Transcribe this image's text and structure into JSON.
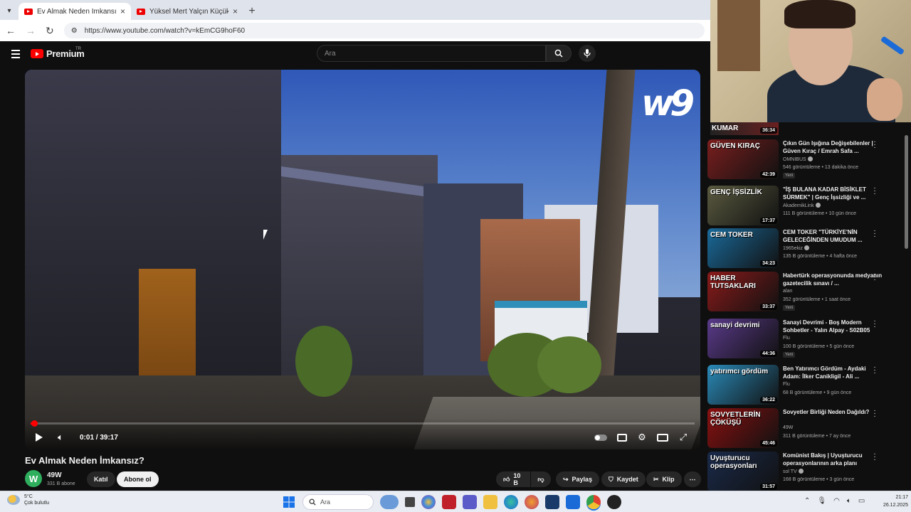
{
  "browser": {
    "tabs": [
      {
        "title": "Ev Almak Neden İmkansız? - Yo",
        "active": true
      },
      {
        "title": "Yüksel Mert Yalçın Küçük Türk",
        "active": false
      }
    ],
    "url": "https://www.youtube.com/watch?v=kEmCG9hoF60"
  },
  "header": {
    "brand": "Premium",
    "region": "TR",
    "search_placeholder": "Ara"
  },
  "player": {
    "watermark": "w9",
    "time": "0:01 / 39:17",
    "progress_fraction": 0.0004
  },
  "video": {
    "title": "Ev Almak Neden İmkansız?",
    "channel": "49W",
    "channel_initial": "W",
    "subscribers": "331 B abone",
    "join_label": "Katıl",
    "subscribe_label": "Abone ol",
    "likes": "10 B",
    "share_label": "Paylaş",
    "save_label": "Kaydet",
    "clip_label": "Klip"
  },
  "sidebar": {
    "partial_thumb_text": "KUMAR",
    "partial_thumb_duration": "36:34",
    "recommendations": [
      {
        "thumb_text": "GÜVEN KIRAÇ",
        "duration": "42:39",
        "title": "Çıkın Gün Işığına Değişebilenler | Güven Kıraç / Emrah Safa ...",
        "channel": "OMNIBUS",
        "verified": true,
        "meta": "546 görüntüleme • 13 dakika önce",
        "badge": "Yeni",
        "bg": "#7a1e1e"
      },
      {
        "thumb_text": "GENÇ İŞSİZLİK",
        "duration": "17:37",
        "title": "\"İŞ BULANA KADAR BİSİKLET SÜRMEK\" | Genç İşsizliği ve ...",
        "channel": "AkademikLink",
        "verified": true,
        "meta": "111 B görüntüleme • 10 gün önce",
        "badge": "",
        "bg": "#5a5a40"
      },
      {
        "thumb_text": "CEM TOKER",
        "duration": "34:23",
        "title": "CEM TOKER \"TÜRKİYE'NİN GELECEĞİNDEN UMUDUM ...",
        "channel": "1965ekiz",
        "verified": true,
        "meta": "135 B görüntüleme • 4 hafta önce",
        "badge": "",
        "bg": "#1a6a9a"
      },
      {
        "thumb_text": "HABER TUTSAKLARI",
        "duration": "33:37",
        "title": "Habertürk operasyonunda medyanın gazetecilik sınavı / ...",
        "channel": "alan",
        "verified": false,
        "meta": "352 görüntüleme • 1 saat önce",
        "badge": "Yeni",
        "bg": "#8a1a1a"
      },
      {
        "thumb_text": "sanayi devrimi",
        "duration": "44:36",
        "title": "Sanayi Devrimi - Boş Modern Sohbetler - Yalın Alpay - S02B05",
        "channel": "Flu",
        "verified": false,
        "meta": "100 B görüntüleme • 5 gün önce",
        "badge": "Yeni",
        "bg": "#5a3a8a"
      },
      {
        "thumb_text": "yatırımcı gördüm",
        "duration": "36:22",
        "title": "Ben Yatırımcı Gördüm - Aydaki Adam: İlker Canikligil - Ali ...",
        "channel": "Flu",
        "verified": false,
        "meta": "68 B görüntüleme • 9 gün önce",
        "badge": "",
        "bg": "#2a8ab8"
      },
      {
        "thumb_text": "SOVYETLERİN ÇÖKÜŞÜ",
        "duration": "45:46",
        "title": "Sovyetler Birliği Neden Dağıldı?",
        "channel": "49W",
        "verified": false,
        "meta": "311 B görüntüleme • 7 ay önce",
        "badge": "",
        "bg": "#8a1010"
      },
      {
        "thumb_text": "Uyuşturucu operasyonları",
        "duration": "31:57",
        "title": "Komünist Bakış | Uyuşturucu operasyonlarının arka planı",
        "channel": "sol TV",
        "verified": true,
        "meta": "168 B görüntüleme • 3 gün önce",
        "badge": "",
        "bg": "#1a2a4a"
      }
    ]
  },
  "taskbar": {
    "temperature": "5°C",
    "weather_desc": "Çok bulutlu",
    "search_placeholder": "Ara",
    "time": "21:17",
    "date": "26.12.2025"
  }
}
